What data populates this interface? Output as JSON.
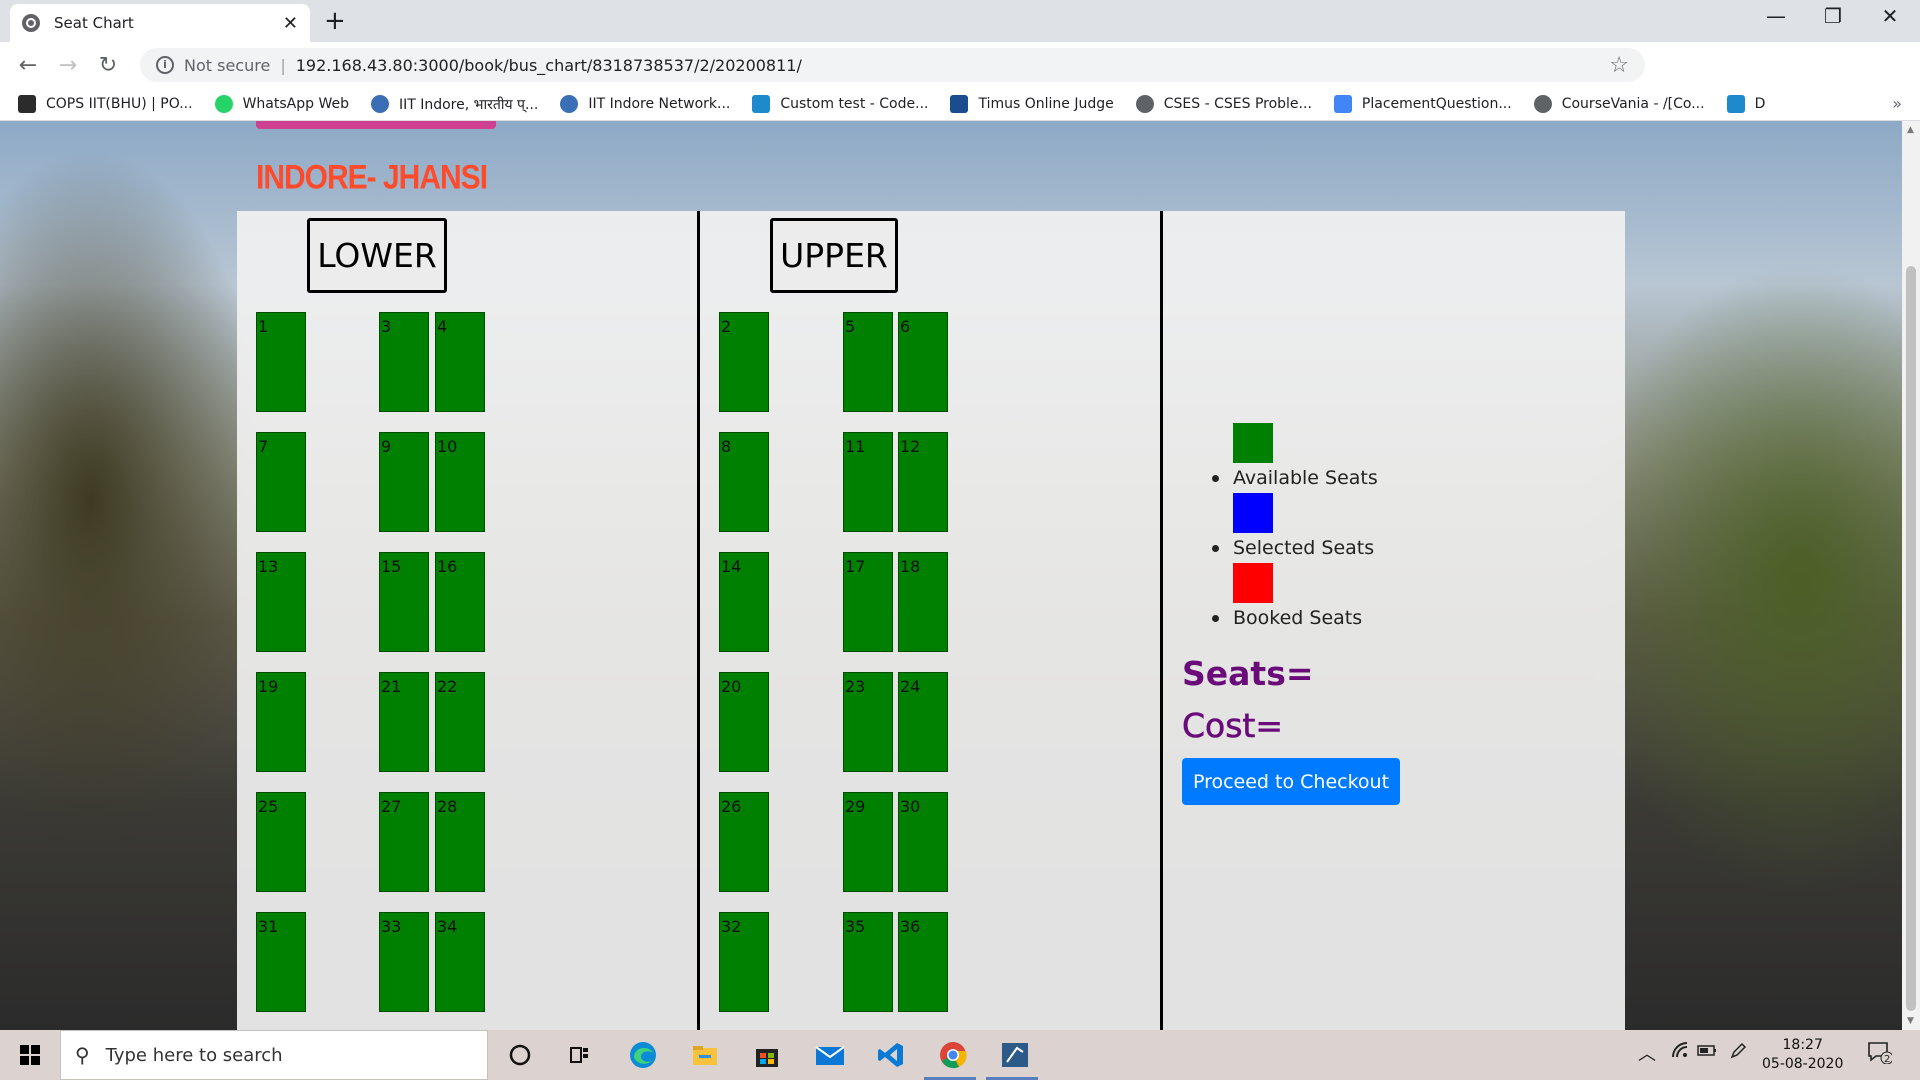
{
  "browser": {
    "tab_title": "Seat Chart",
    "tab_close": "✕",
    "new_tab": "+",
    "minimize": "—",
    "restore": "❐",
    "close": "✕",
    "not_secure": "Not secure",
    "separator": "|",
    "url": "192.168.43.80:3000/book/bus_chart/8318738537/2/20200811/",
    "bookmarks": [
      {
        "label": "COPS IIT(BHU) | PO...",
        "icon": "cops-icon",
        "color": "#2b2b2b"
      },
      {
        "label": "WhatsApp Web",
        "icon": "whatsapp-icon",
        "color": "#25d366"
      },
      {
        "label": "IIT Indore, भारतीय प्...",
        "icon": "iit-indore-icon",
        "color": "#3b6fb5"
      },
      {
        "label": "IIT Indore Network...",
        "icon": "iit-network-icon",
        "color": "#3b6fb5"
      },
      {
        "label": "Custom test - Code...",
        "icon": "codeforces-icon",
        "color": "#1f8acb"
      },
      {
        "label": "Timus Online Judge",
        "icon": "timus-icon",
        "color": "#1a4d8f"
      },
      {
        "label": "CSES - CSES Proble...",
        "icon": "cses-icon",
        "color": "#5f6368"
      },
      {
        "label": "PlacementQuestion...",
        "icon": "docs-icon",
        "color": "#4285f4"
      },
      {
        "label": "CourseVania - /[Co...",
        "icon": "coursevania-icon",
        "color": "#5f6368"
      },
      {
        "label": "D",
        "icon": "codeforces-icon",
        "color": "#1f8acb"
      }
    ],
    "bookmarks_more": "»"
  },
  "page": {
    "route": "INDORE- JHANSI",
    "lower_label": "LOWER",
    "upper_label": "UPPER",
    "legend": [
      {
        "label": "Available Seats",
        "color": "#008000"
      },
      {
        "label": "Selected Seats",
        "color": "#0000ff"
      },
      {
        "label": "Booked Seats",
        "color": "#ff0000"
      }
    ],
    "seats_label": "Seats=",
    "cost_label": "Cost=",
    "checkout_label": "Proceed to Checkout",
    "seat_color_available": "#008000",
    "lower_seats": [
      [
        "1",
        "3",
        "4"
      ],
      [
        "7",
        "9",
        "10"
      ],
      [
        "13",
        "15",
        "16"
      ],
      [
        "19",
        "21",
        "22"
      ],
      [
        "25",
        "27",
        "28"
      ],
      [
        "31",
        "33",
        "34"
      ]
    ],
    "upper_seats": [
      [
        "2",
        "5",
        "6"
      ],
      [
        "8",
        "11",
        "12"
      ],
      [
        "14",
        "17",
        "18"
      ],
      [
        "20",
        "23",
        "24"
      ],
      [
        "26",
        "29",
        "30"
      ],
      [
        "32",
        "35",
        "36"
      ]
    ]
  },
  "taskbar": {
    "search_placeholder": "Type here to search",
    "time": "18:27",
    "date": "05-08-2020",
    "notification_count": "2"
  }
}
